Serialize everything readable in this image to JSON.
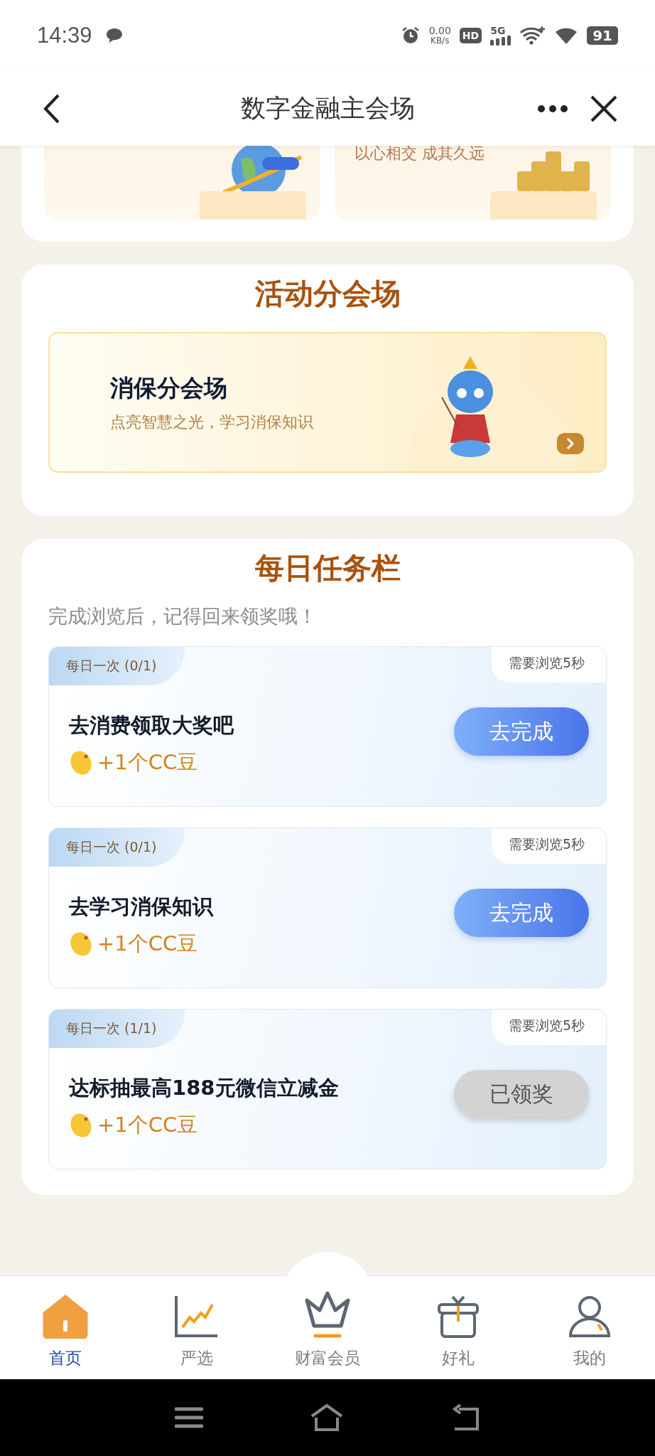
{
  "status_bar": {
    "time": "14:39",
    "net_speed": "0.00",
    "net_unit": "KB/s",
    "hd": "HD",
    "network": "5G",
    "battery": "91"
  },
  "nav_bar": {
    "title": "数字金融主会场"
  },
  "promo_cards": [
    {
      "kind": "travel"
    },
    {
      "kind": "coins",
      "subtitle": "以心相交 成其久远"
    }
  ],
  "activity_section": {
    "title": "活动分会场",
    "banner": {
      "title": "消保分会场",
      "subtitle": "点亮智慧之光，学习消保知识"
    }
  },
  "task_section": {
    "title": "每日任务栏",
    "hint": "完成浏览后，记得回来领奖哦！",
    "tasks": [
      {
        "frequency": "每日一次 (0/1)",
        "requirement": "需要浏览5秒",
        "title": "去消费领取大奖吧",
        "reward": "+1个CC豆",
        "button": "去完成",
        "completed": false
      },
      {
        "frequency": "每日一次 (0/1)",
        "requirement": "需要浏览5秒",
        "title": "去学习消保知识",
        "reward": "+1个CC豆",
        "button": "去完成",
        "completed": false
      },
      {
        "frequency": "每日一次 (1/1)",
        "requirement": "需要浏览5秒",
        "title": "达标抽最高188元微信立减金",
        "reward": "+1个CC豆",
        "button": "已领奖",
        "completed": true
      }
    ]
  },
  "tab_bar": [
    {
      "label": "首页",
      "selected": true
    },
    {
      "label": "严选",
      "selected": false
    },
    {
      "label": "财富会员",
      "selected": false
    },
    {
      "label": "好礼",
      "selected": false
    },
    {
      "label": "我的",
      "selected": false
    }
  ]
}
